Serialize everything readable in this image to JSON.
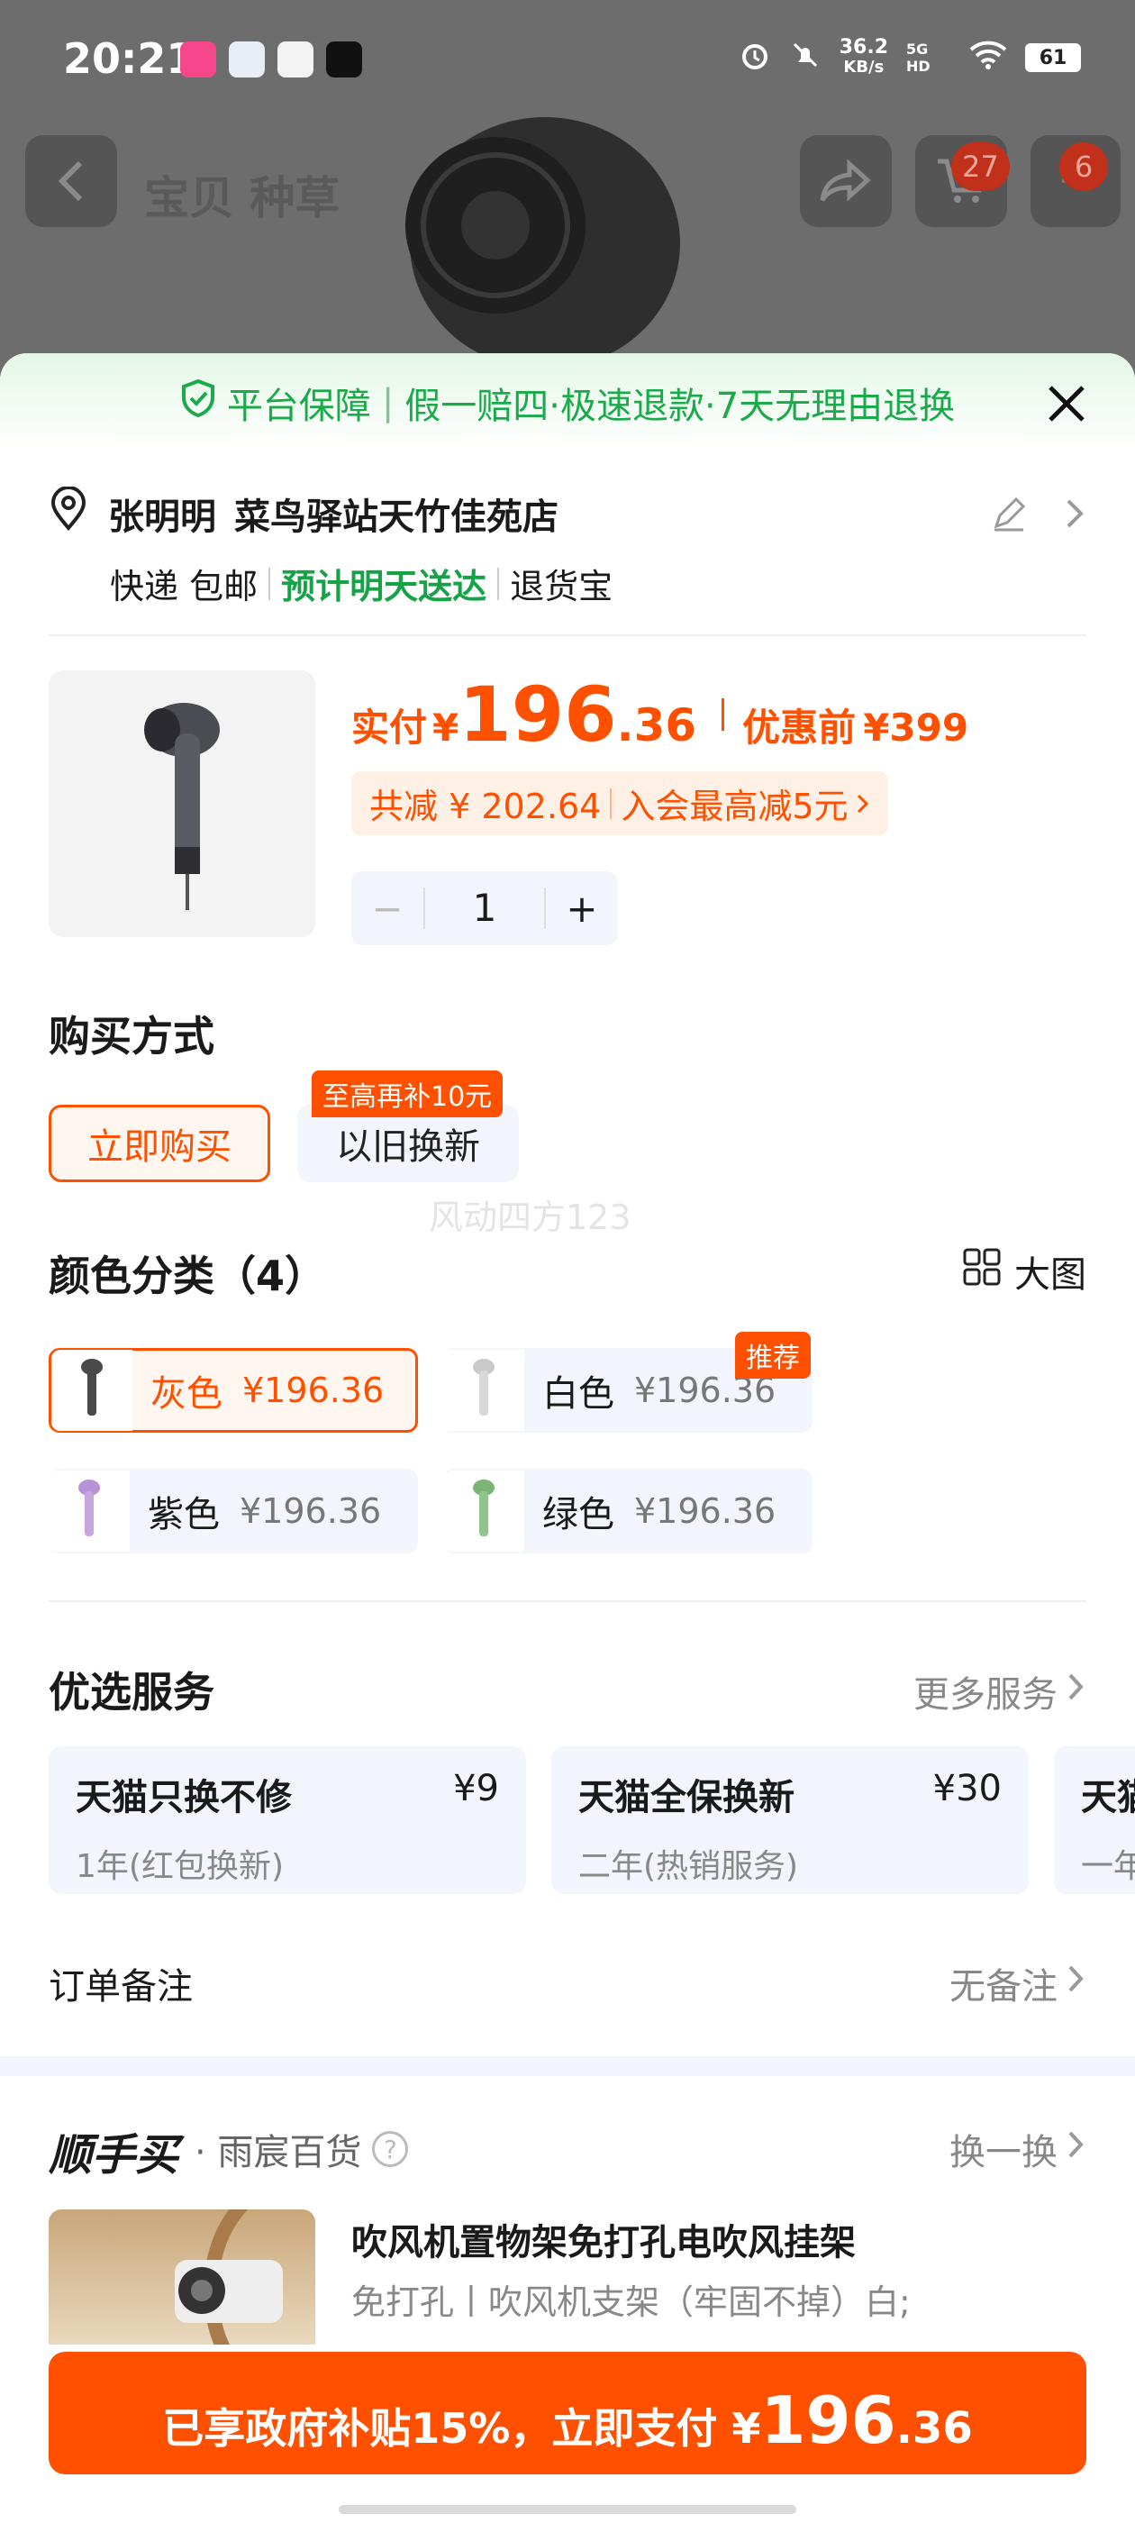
{
  "status": {
    "time": "20:21",
    "speed_value": "36.2",
    "speed_unit": "KB/s",
    "network": "5G HD",
    "battery": "61"
  },
  "nav": {
    "tabs": "宝贝  种草",
    "cart_badge": "27",
    "more_badge": "6"
  },
  "guarantee": {
    "title": "平台保障",
    "items": "假一赔四·极速退款·7天无理由退换"
  },
  "address": {
    "recipient": "张明明",
    "location": "菜鸟驿站天竹佳苑店",
    "shipping": "快递 包邮",
    "delivery": "预计明天送达",
    "service": "退货宝"
  },
  "product": {
    "paid_label": "实付",
    "currency": "¥",
    "price_int": "196",
    "price_dec": ".36",
    "orig_label": "优惠前",
    "orig_price": "¥399",
    "discount_total": "共减 ¥ 202.64",
    "member_offer": "入会最高减5元",
    "quantity": "1",
    "minus": "−",
    "plus": "+"
  },
  "purchase": {
    "title": "购买方式",
    "options": [
      "立即购买",
      "以旧换新"
    ],
    "tradein_tag": "至高再补10元"
  },
  "watermark": "风动四方123",
  "colors": {
    "title": "颜色分类（4）",
    "big_view": "大图",
    "recommend_tag": "推荐",
    "items": [
      {
        "name": "灰色",
        "price": "¥196.36",
        "swatch": "#4a4a4a"
      },
      {
        "name": "白色",
        "price": "¥196.36",
        "swatch": "#d8d8d8"
      },
      {
        "name": "紫色",
        "price": "¥196.36",
        "swatch": "#c7a6e0"
      },
      {
        "name": "绿色",
        "price": "¥196.36",
        "swatch": "#8fc48a"
      }
    ]
  },
  "services": {
    "title": "优选服务",
    "more": "更多服务",
    "items": [
      {
        "name": "天猫只换不修",
        "price": "¥9",
        "desc": "1年(红包换新)"
      },
      {
        "name": "天猫全保换新",
        "price": "¥30",
        "desc": "二年(热销服务)"
      },
      {
        "name": "天猫",
        "price": "",
        "desc": "一年"
      }
    ]
  },
  "note": {
    "label": "订单备注",
    "value": "无备注"
  },
  "shunshoumai": {
    "logo": "顺手买",
    "store": "· 雨宸百货",
    "help": "?",
    "swap": "换一换",
    "item_title": "吹风机置物架免打孔电吹风挂架",
    "item_desc": "免打孔丨吹风机支架（牢固不掉）白;"
  },
  "pay": {
    "text": "已享政府补贴15%，立即支付 ¥",
    "amount_int": "196",
    "amount_dec": ".36"
  },
  "theme": {
    "accent": "#ff5000",
    "green": "#16a347"
  }
}
